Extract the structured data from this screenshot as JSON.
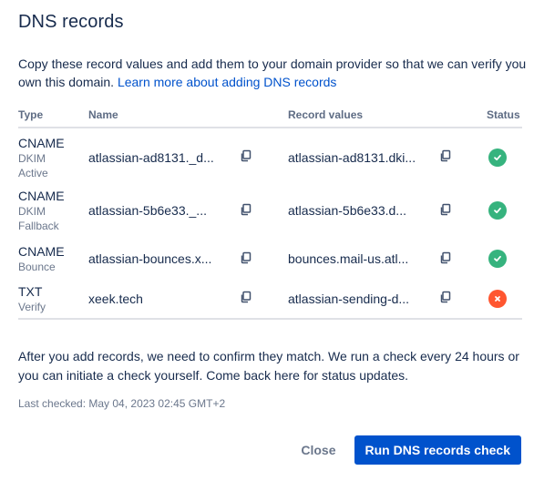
{
  "dialog": {
    "title": "DNS records",
    "intro_text": "Copy these record values and add them to your domain provider so that we can verify you own this domain. ",
    "intro_link": "Learn more about adding DNS records",
    "outro_text": "After you add records, we need to confirm they match. We run a check every 24 hours or you can initiate a check yourself. Come back here for status updates.",
    "last_checked": "Last checked: May 04, 2023 02:45 GMT+2",
    "close_label": "Close",
    "primary_label": "Run DNS records check"
  },
  "table": {
    "headers": {
      "type": "Type",
      "name": "Name",
      "values": "Record values",
      "status": "Status"
    },
    "rows": [
      {
        "type": "CNAME",
        "sub": "DKIM Active",
        "sub1": "DKIM",
        "sub2": "Active",
        "name": "atlassian-ad8131._d...",
        "value": "atlassian-ad8131.dki...",
        "status": "verified"
      },
      {
        "type": "CNAME",
        "sub": "DKIM Fallback",
        "sub1": "DKIM",
        "sub2": "Fallback",
        "name": "atlassian-5b6e33._...",
        "value": "atlassian-5b6e33.d...",
        "status": "verified"
      },
      {
        "type": "CNAME",
        "sub": "Bounce",
        "sub1": "Bounce",
        "sub2": "",
        "name": "atlassian-bounces.x...",
        "value": "bounces.mail-us.atl...",
        "status": "verified"
      },
      {
        "type": "TXT",
        "sub": "Verify",
        "sub1": "Verify",
        "sub2": "",
        "name": "xeek.tech",
        "value": "atlassian-sending-d...",
        "status": "failed"
      }
    ]
  },
  "colors": {
    "success": "#36b37e",
    "error": "#ff5630",
    "primary": "#0052cc",
    "link": "#0052cc"
  },
  "icons": {
    "copy": "copy-icon",
    "success": "check-circle-icon",
    "error": "cross-circle-icon"
  }
}
